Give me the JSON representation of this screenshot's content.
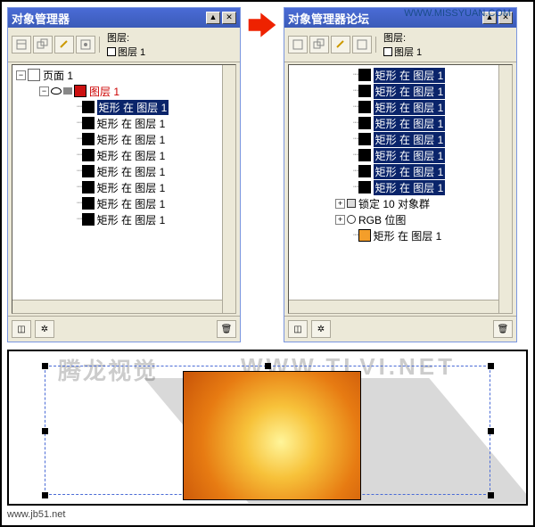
{
  "left_panel": {
    "title": "对象管理器",
    "layer_label": "图层:",
    "layer_name": "图层 1",
    "page_label": "页面 1",
    "layer1_label": "图层 1",
    "items": [
      "矩形 在 图层 1",
      "矩形 在 图层 1",
      "矩形 在 图层 1",
      "矩形 在 图层 1",
      "矩形 在 图层 1",
      "矩形 在 图层 1",
      "矩形 在 图层 1",
      "矩形 在 图层 1"
    ],
    "selected_index": 0
  },
  "right_panel": {
    "title": "对象管理器论坛",
    "top_url": "WWW.MISSYUAN.COM",
    "layer_label": "图层:",
    "layer_name": "图层 1",
    "selected_items": [
      "矩形 在 图层 1",
      "矩形 在 图层 1",
      "矩形 在 图层 1",
      "矩形 在 图层 1",
      "矩形 在 图层 1",
      "矩形 在 图层 1",
      "矩形 在 图层 1",
      "矩形 在 图层 1"
    ],
    "lock_label": "锁定 10 对象群",
    "rgb_label": "RGB 位图",
    "bottom_item": "矩形 在 图层 1"
  },
  "watermarks": {
    "wm1": "腾龙视觉",
    "wm2": "WWW.TLVI.NET",
    "site": "www.jb51.net"
  }
}
